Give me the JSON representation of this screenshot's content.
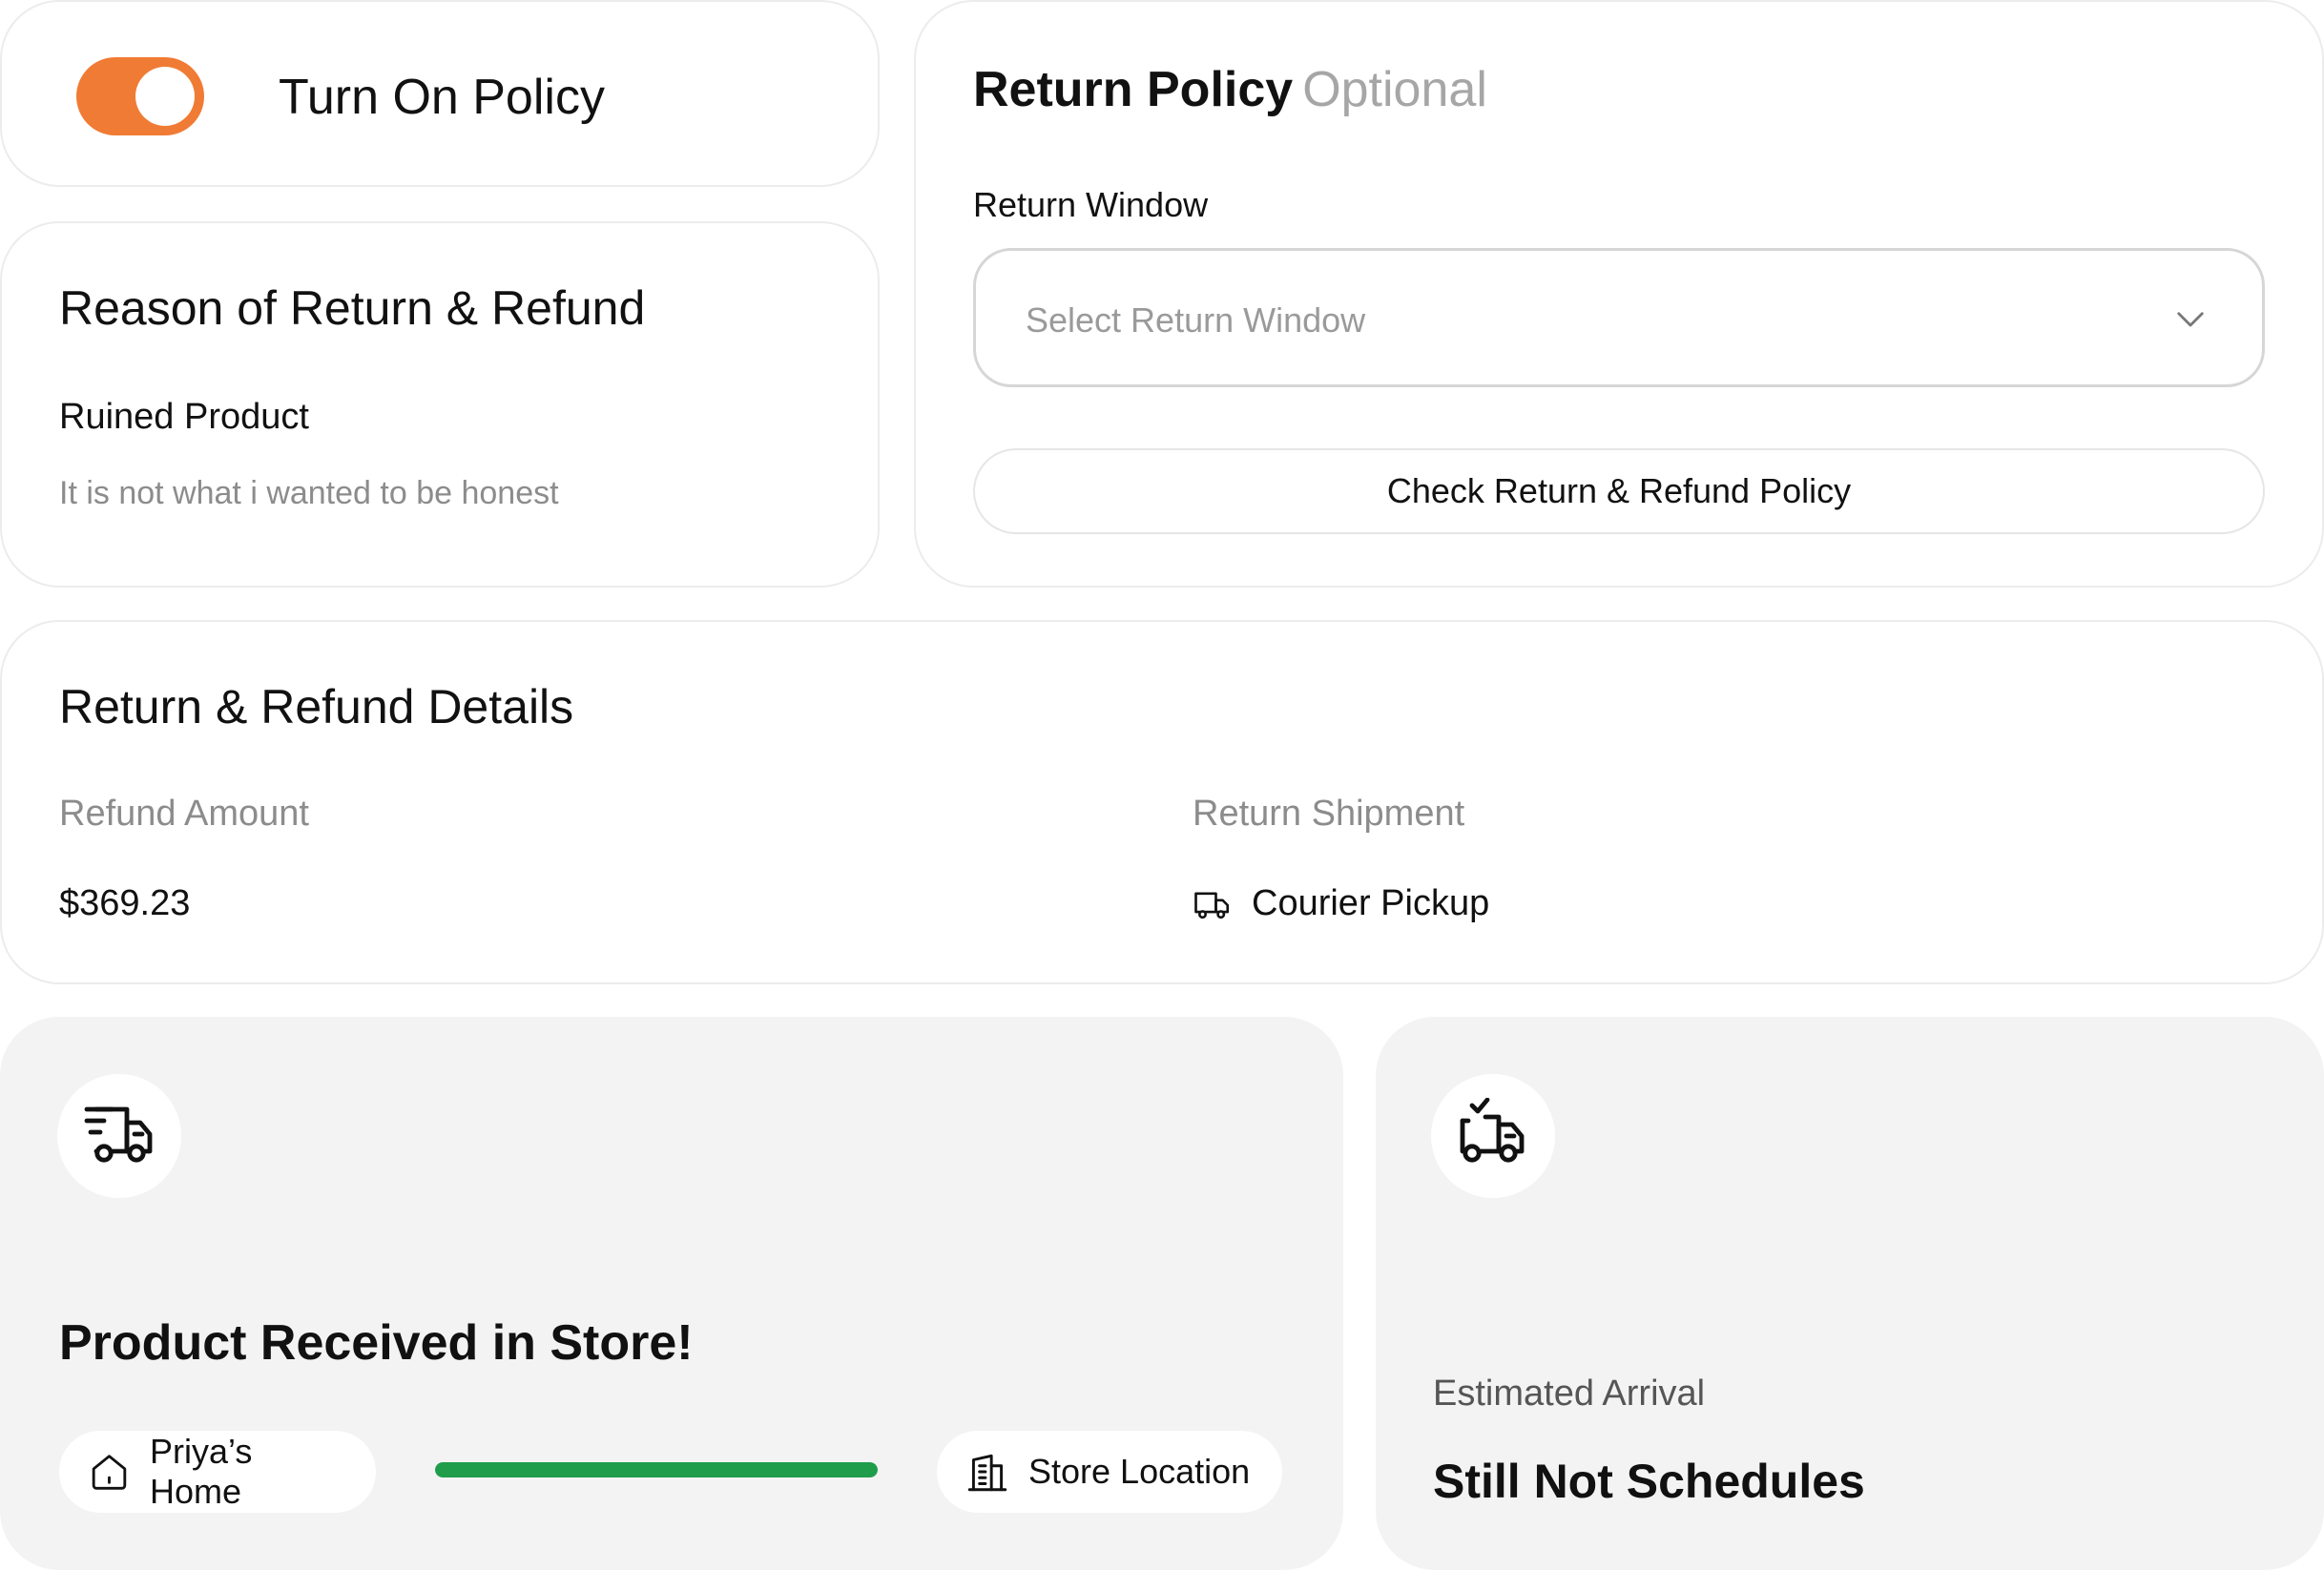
{
  "policy_toggle": {
    "label": "Turn On Policy",
    "enabled": true,
    "accent_color": "#f07b34"
  },
  "reason": {
    "title": "Reason of Return & Refund",
    "selected_reason": "Ruined Product",
    "note": "It is not what i wanted to be honest"
  },
  "return_policy": {
    "title": "Return Policy",
    "optional_tag": "Optional",
    "window_label": "Return Window",
    "window_placeholder": "Select Return Window",
    "window_value": "",
    "check_button_label": "Check Return & Refund Policy",
    "chevron_icon": "chevron-down-icon"
  },
  "details": {
    "title": "Return & Refund Details",
    "refund_amount_label": "Refund Amount",
    "refund_amount_value": "$369.23",
    "shipment_label": "Return Shipment",
    "shipment_value": "Courier Pickup",
    "shipment_icon": "truck-icon"
  },
  "tracking": {
    "icon": "fast-delivery-truck-icon",
    "headline": "Product Received in Store!",
    "origin_label": "Priya’s Home",
    "origin_icon": "home-icon",
    "destination_label": "Store Location",
    "destination_icon": "building-icon",
    "progress_fraction": 1.0,
    "progress_color": "#1f9d4b"
  },
  "arrival": {
    "icon": "truck-check-icon",
    "label": "Estimated Arrival",
    "value": "Still Not Schedules"
  }
}
